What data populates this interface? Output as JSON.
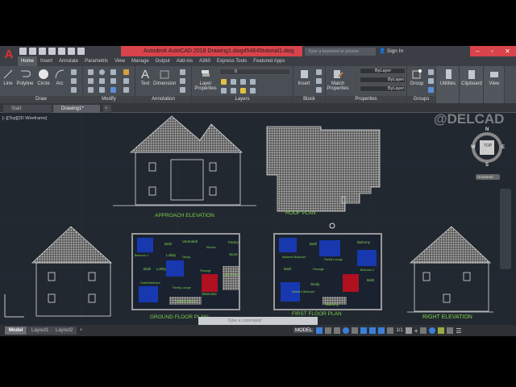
{
  "app": {
    "title": "Autodesk AutoCAD 2018    Drawing1.dwg454645tutorial1.dwg",
    "search_placeholder": "Type a keyword or phrase",
    "signin": "Sign In",
    "logo": "A"
  },
  "ribbon_tabs": [
    "Home",
    "Insert",
    "Annotate",
    "Parametric",
    "View",
    "Manage",
    "Output",
    "Add-ins",
    "A360",
    "Express Tools",
    "Featured Apps"
  ],
  "panels": {
    "draw": {
      "label": "Draw",
      "tools": [
        "Line",
        "Polyline",
        "Circle",
        "Arc"
      ]
    },
    "modify": {
      "label": "Modify"
    },
    "annotation": {
      "label": "Annotation",
      "tools": [
        "Text",
        "Dimension"
      ]
    },
    "layers": {
      "label": "Layers",
      "tool": "Layer Properties",
      "layer_value": "0"
    },
    "block": {
      "label": "Block",
      "tool": "Insert"
    },
    "properties": {
      "label": "Properties",
      "tool": "Match Properties",
      "color": "ByLayer",
      "linetype": "ByLayer",
      "lineweight": "ByLayer"
    },
    "groups": {
      "label": "Groups",
      "tool": "Group"
    },
    "utilities": {
      "label": "Utilities"
    },
    "clipboard": {
      "label": "Clipboard"
    },
    "view": {
      "label": "View"
    }
  },
  "file_tabs": [
    "Start",
    "Drawing1*"
  ],
  "viewport": {
    "label": "[−][Top][2D Wireframe]",
    "watermark": "@DELCAD",
    "viewcube": {
      "n": "N",
      "s": "S",
      "e": "E",
      "w": "W",
      "face": "TOP"
    },
    "ucs_name": "Unnamed"
  },
  "drawing_labels": {
    "approach": "APPROACH ELEVATION",
    "roof": "ROOF PLAN",
    "ground": "GROUND FLOOR PLAN",
    "first": "FIRST FLOOR PLAN",
    "right": "RIGHT ELEVATION"
  },
  "rooms": {
    "ground": [
      "Bedroom 1",
      "Bath",
      "Lobby",
      "Verandah",
      "Dining",
      "Kitchen",
      "Store",
      "Pantry",
      "Bath",
      "Lobby",
      "Guest Bedroom",
      "Family Lounge",
      "Passage",
      "Car Port",
      "Staircase",
      "Visitor Room"
    ],
    "first": [
      "Madam's Bedroom",
      "Bath",
      "Family Lounge",
      "Balcony",
      "Bedroom 2",
      "Bath",
      "Passage",
      "Study",
      "Master's Bedroom",
      "Balcony",
      "Bath"
    ]
  },
  "command": {
    "placeholder": "Type a command"
  },
  "layout_tabs": [
    "Model",
    "Layout1",
    "Layout2"
  ],
  "status": {
    "model": "MODEL",
    "scale": "1/1"
  }
}
